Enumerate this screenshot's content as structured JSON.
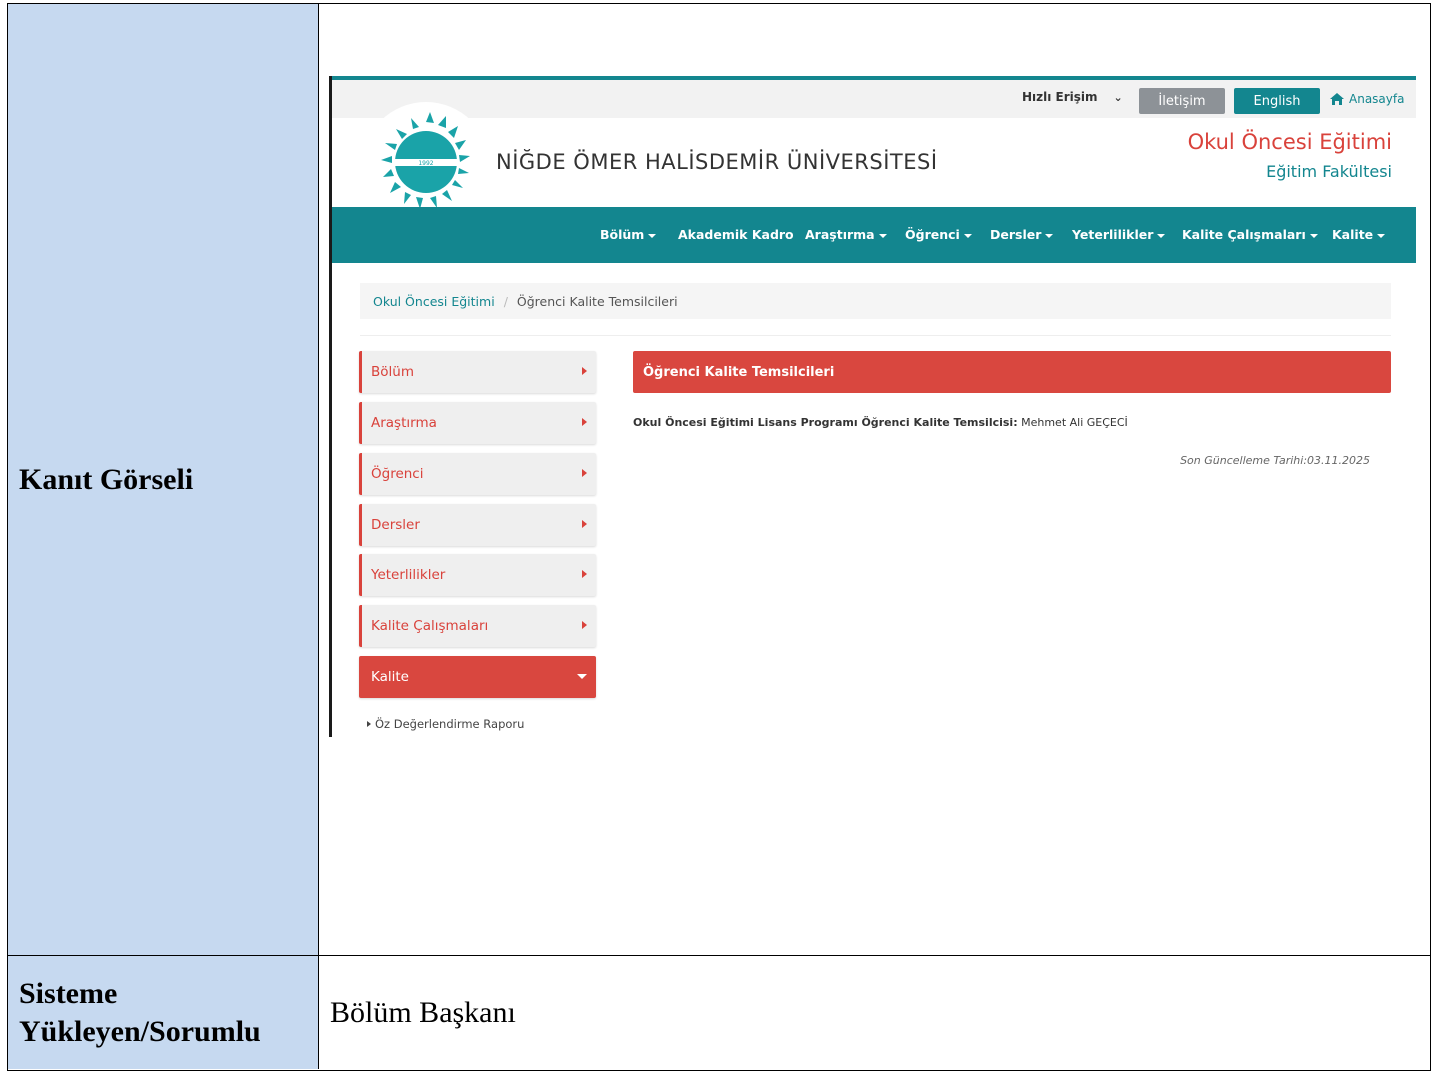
{
  "rows": [
    {
      "label": "Kanıt Görseli"
    },
    {
      "label": "Sisteme Yükleyen/Sorumlu",
      "value": "Bölüm Başkanı"
    }
  ],
  "site": {
    "topbar": {
      "quick_access": "Hızlı Erişim",
      "contact": "İletişim",
      "english": "English",
      "home": "Anasayfa"
    },
    "header": {
      "logo_year": "1992",
      "university": "NİĞDE ÖMER HALİSDEMİR ÜNİVERSİTESİ",
      "program": "Okul Öncesi Eğitimi",
      "faculty": "Eğitim Fakültesi"
    },
    "nav": [
      "Bölüm",
      "Akademik Kadro",
      "Araştırma",
      "Öğrenci",
      "Dersler",
      "Yeterlilikler",
      "Kalite Çalışmaları",
      "Kalite"
    ],
    "breadcrumb": {
      "home": "Okul Öncesi Eğitimi",
      "separator": "/",
      "current": "Öğrenci Kalite Temsilcileri"
    },
    "sidebar": [
      "Bölüm",
      "Araştırma",
      "Öğrenci",
      "Dersler",
      "Yeterlilikler",
      "Kalite Çalışmaları",
      "Kalite"
    ],
    "sidebar_sub": "Öz Değerlendirme Raporu",
    "content": {
      "title": "Öğrenci Kalite Temsilcileri",
      "label": "Okul Öncesi Eğitimi Lisans Programı Öğrenci Kalite Temsilcisi:",
      "name": "Mehmet Ali GEÇECİ",
      "updated": "Son Güncelleme Tarihi:03.11.2025"
    },
    "colors": {
      "teal": "#13868f",
      "red": "#d9473f",
      "label_bg": "#c6d9f0"
    }
  }
}
